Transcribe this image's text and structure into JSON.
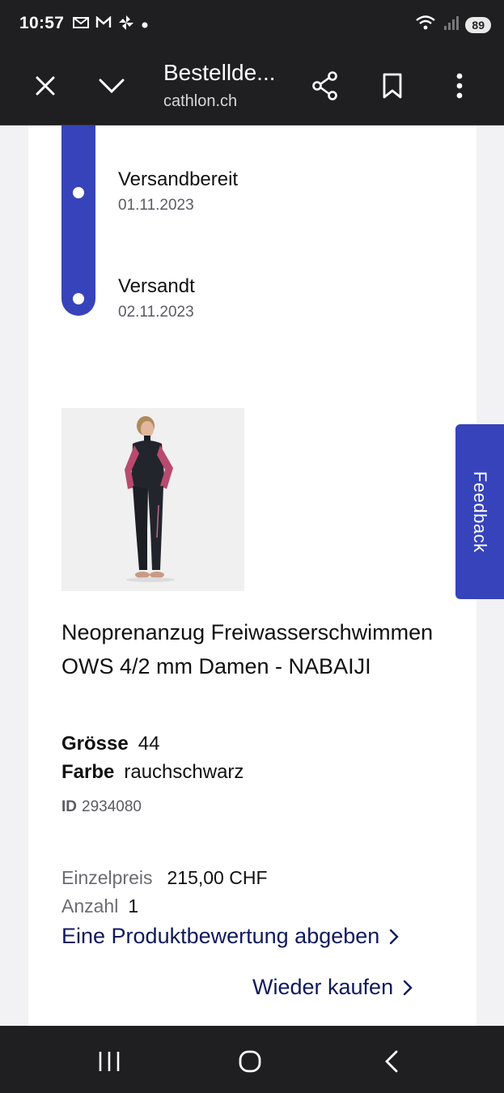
{
  "status_bar": {
    "time": "10:57",
    "battery": "89",
    "icons": [
      "mail-icon",
      "gmail-icon",
      "pinwheel-icon",
      "dot-icon",
      "wifi-icon",
      "signal-icon"
    ]
  },
  "toolbar": {
    "title": "Bestellde...",
    "url": "cathlon.ch"
  },
  "timeline": [
    {
      "label": "Versandbereit",
      "date": "01.11.2023"
    },
    {
      "label": "Versandt",
      "date": "02.11.2023"
    }
  ],
  "product": {
    "title": "Neoprenanzug Freiwasserschwimmen OWS 4/2 mm Damen - NABAIJI",
    "size_label": "Grösse",
    "size_value": "44",
    "color_label": "Farbe",
    "color_value": "rauchschwarz",
    "id_label": "ID",
    "id_value": "2934080",
    "unit_price_label": "Einzelpreis",
    "unit_price_value": "215,00 CHF",
    "quantity_label": "Anzahl",
    "quantity_value": "1"
  },
  "actions": {
    "review": "Eine Produktbewertung abgeben",
    "rebuy": "Wieder kaufen"
  },
  "feedback_tab": "Feedback",
  "colors": {
    "accent": "#3643ba",
    "link": "#101a5c",
    "chrome": "#1f1f21"
  }
}
